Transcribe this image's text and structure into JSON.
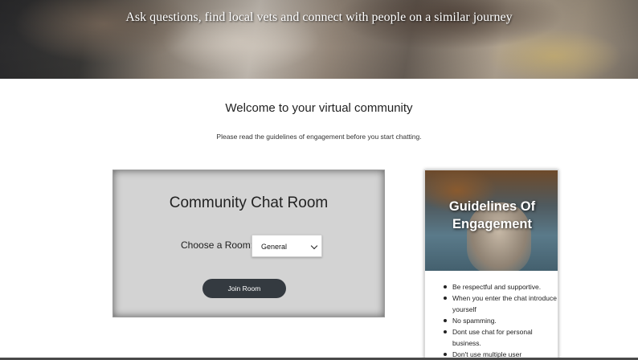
{
  "hero": {
    "tagline": "Ask questions, find local vets and connect with people on a similar journey"
  },
  "welcome": {
    "title": "Welcome to your virtual community",
    "subtitle": "Please read the guidelines of engagement before you start chatting."
  },
  "chat_room": {
    "title": "Community Chat Room",
    "room_label": "Choose a Room:",
    "room_selected": "General",
    "join_label": "Join Room",
    "button_color": "#343a40",
    "card_color": "#d3d3d3"
  },
  "guidelines": {
    "title": "Guidelines Of Engagement",
    "items": [
      "Be respectful and supportive.",
      "When you enter the chat introduce yourself",
      "No spamming.",
      "Dont use chat for personal business.",
      "Don't use multiple user"
    ]
  }
}
